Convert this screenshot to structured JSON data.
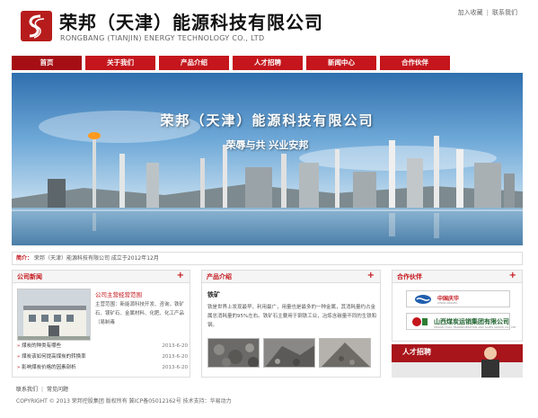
{
  "header": {
    "company_cn": "荣邦（天津）能源科技有限公司",
    "company_en": "RONGBANG (TIANJIN) ENERGY TECHNOLOGY CO., LTD",
    "top_links": {
      "favorite": "加入收藏",
      "separator": "|",
      "contact": "联系我们"
    }
  },
  "nav": {
    "items": [
      "首页",
      "关于我们",
      "产品介绍",
      "人才招聘",
      "新闻中心",
      "合作伙伴"
    ]
  },
  "banner": {
    "title": "荣邦（天津）能源科技有限公司",
    "slogan": "荣辱与共  兴业安邦"
  },
  "notice": {
    "label": "简介：",
    "text": "荣邦（天津）能源科技有限公司 成立于2012年12月"
  },
  "news": {
    "title": "公司新闻",
    "plus": "+",
    "feature_title": "公司主营经营范围",
    "feature_body": "主营范围：新能源科技开发、咨询，铁矿石、镁矿石、金属材料、化肥、化工产品（易制毒",
    "items": [
      {
        "title": "煤炭的种类有哪些",
        "date": "2013-6-20"
      },
      {
        "title": "煤炭该如何提高煤炭的转换率",
        "date": "2013-6-20"
      },
      {
        "title": "影响煤炭价格的因素剖析",
        "date": "2013-6-20"
      }
    ]
  },
  "products": {
    "title": "产品介绍",
    "plus": "+",
    "name": "铁矿",
    "desc": "铁是世界上发现最早，利用最广，用量也是最多的一种金属，其消耗量约占金属总消耗量的95%左右。铁矿石主要用于钢铁工业，冶炼含碳量不同的生铁和钢。"
  },
  "partners": {
    "title": "合作伙伴",
    "plus": "+",
    "p1_name": "中国庆华",
    "p1_en": "CHINA KINGHO",
    "p2_name": "山西煤炭运销集团有限公司",
    "p2_en": "SHANXI COAL TRANSPORTATION AND SALES GROUP CO., LTD"
  },
  "recruit": {
    "label": "人才招聘"
  },
  "footer": {
    "links": [
      "联系我们",
      "常见问题"
    ],
    "separator": "|",
    "copyright": "COPYRIGHT © 2013 荣邦控股集团 版权所有  冀ICP备05012162号  技术支持：华易动力"
  },
  "colors": {
    "brand_red": "#c4161c",
    "dark_red": "#b71c1c",
    "sky": "#4a8fc8"
  }
}
